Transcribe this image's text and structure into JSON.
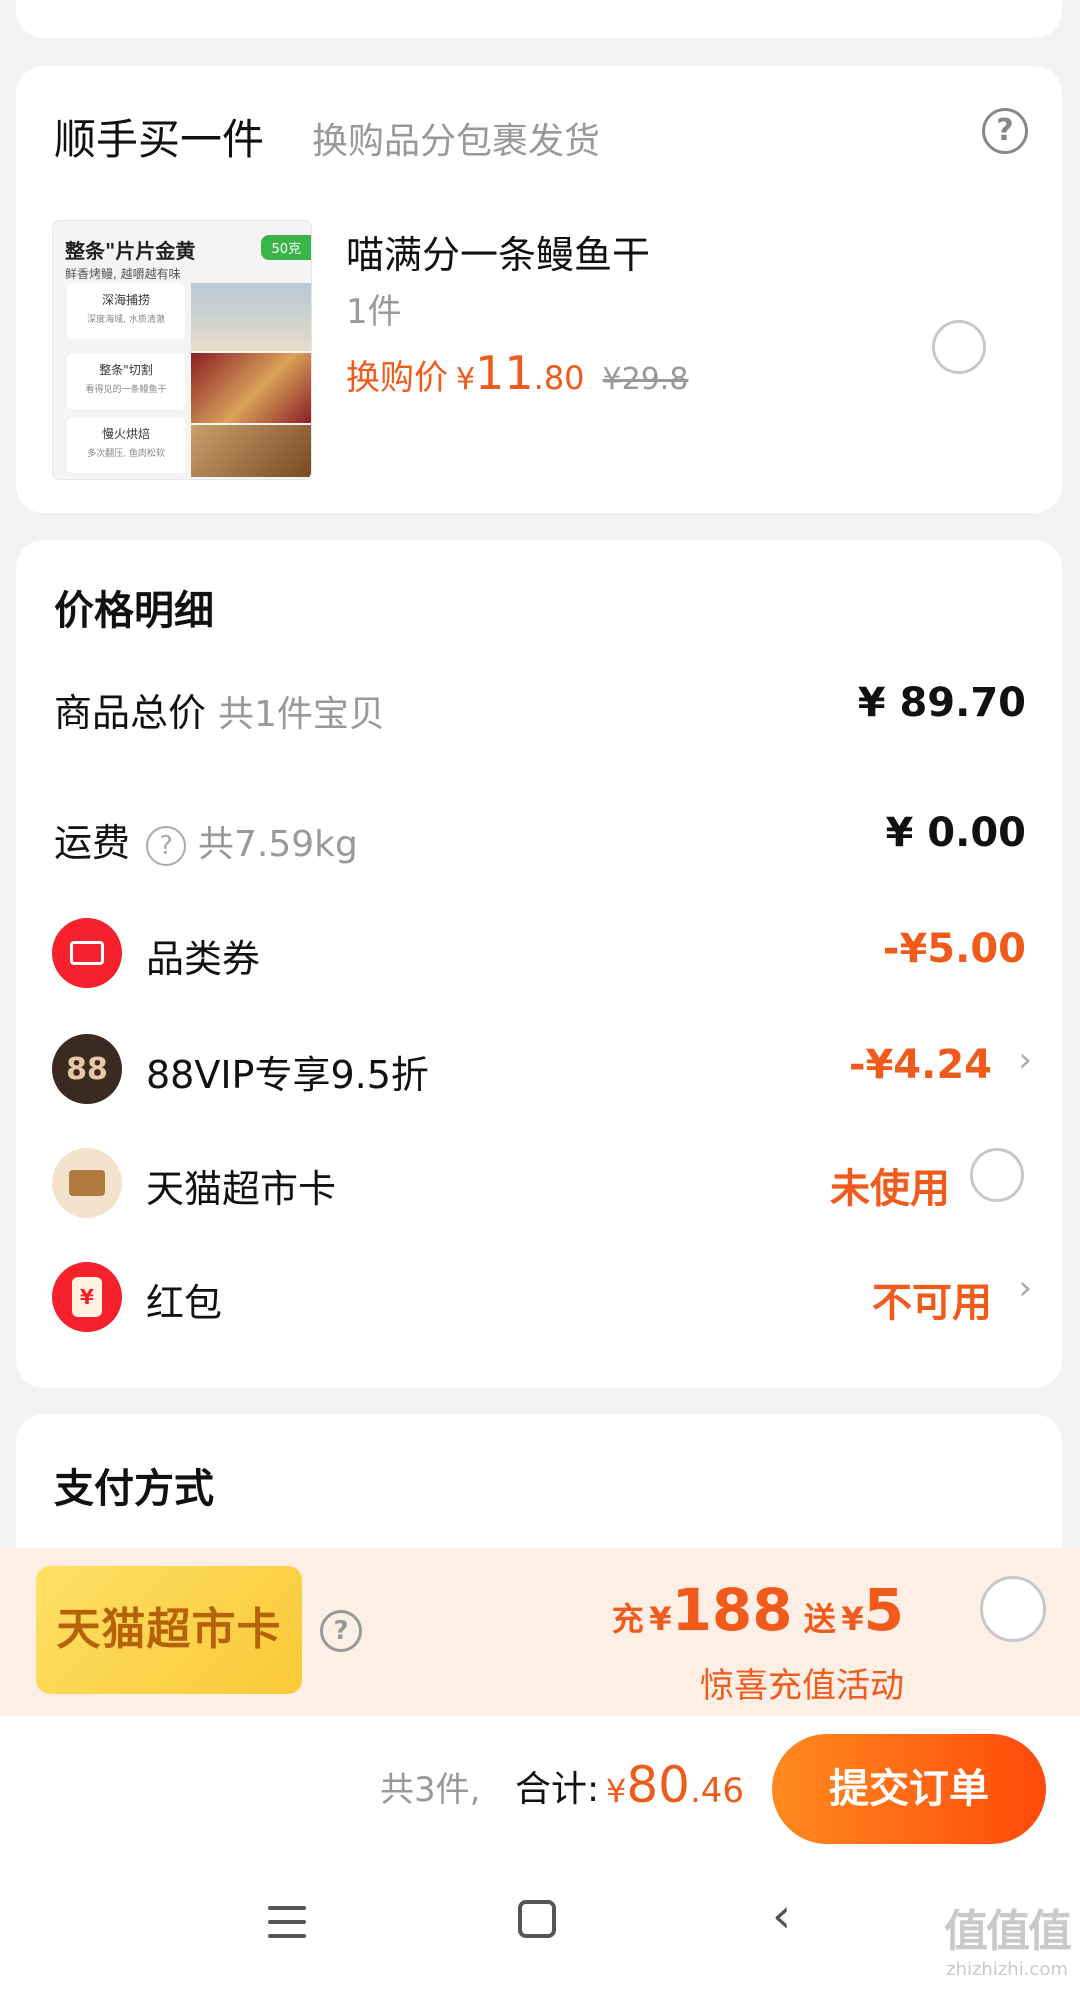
{
  "addon": {
    "title": "顺手买一件",
    "subtitle": "换购品分包裹发货",
    "help_symbol": "?",
    "product": {
      "image": {
        "title": "整条\"片片金黄",
        "tag": "50克",
        "sub": "鲜香烤鳗, 越嚼越有味",
        "row1": "深海捕捞",
        "row1_sub": "深度海域, 水质清澈",
        "row2": "整条\"切割",
        "row2_sub": "看得见的一条鳗鱼干",
        "row3": "慢火烘焙",
        "row3_sub": "多次翻压, 鱼肉松软"
      },
      "name": "喵满分一条鳗鱼干",
      "qty": "1件",
      "price_label": "换购价",
      "currency": "¥",
      "price_int": "11",
      "price_dec": ".80",
      "orig_price": "¥29.8"
    }
  },
  "price_detail": {
    "title": "价格明细",
    "goods_total_label": "商品总价",
    "goods_total_note": "共1件宝贝",
    "goods_total_value": "¥ 89.70",
    "shipping_label": "运费",
    "shipping_help": "?",
    "shipping_note": "共7.59kg",
    "shipping_value": "¥ 0.00",
    "coupon_label": "品类券",
    "coupon_value": "-¥5.00",
    "vip_icon_text": "88",
    "vip_label": "88VIP专享9.5折",
    "vip_value": "-¥4.24",
    "card_label": "天猫超市卡",
    "card_value": "未使用",
    "redpack_icon_text": "¥",
    "redpack_label": "红包",
    "redpack_value": "不可用",
    "chevron": "›"
  },
  "payment": {
    "title": "支付方式"
  },
  "promo": {
    "card_text": "天猫超市卡",
    "help_symbol": "?",
    "charge_word": "充",
    "currency": "¥",
    "charge_amount": "188",
    "gift_word": "送",
    "gift_amount": "5",
    "subtitle": "惊喜充值活动"
  },
  "bottom": {
    "count": "共3件,",
    "total_label": "合计:",
    "currency": "¥",
    "total_int": "80",
    "total_dec": ".46",
    "submit_label": "提交订单"
  },
  "nav": {
    "back_symbol": "‹",
    "watermark_main": "值值值",
    "watermark_sub": "zhizhizhi.com"
  },
  "colors": {
    "accent": "#f05a1a",
    "coupon_red": "#f5222d",
    "vip_dark": "#3a2a22",
    "card_beige": "#f3e3cc"
  }
}
